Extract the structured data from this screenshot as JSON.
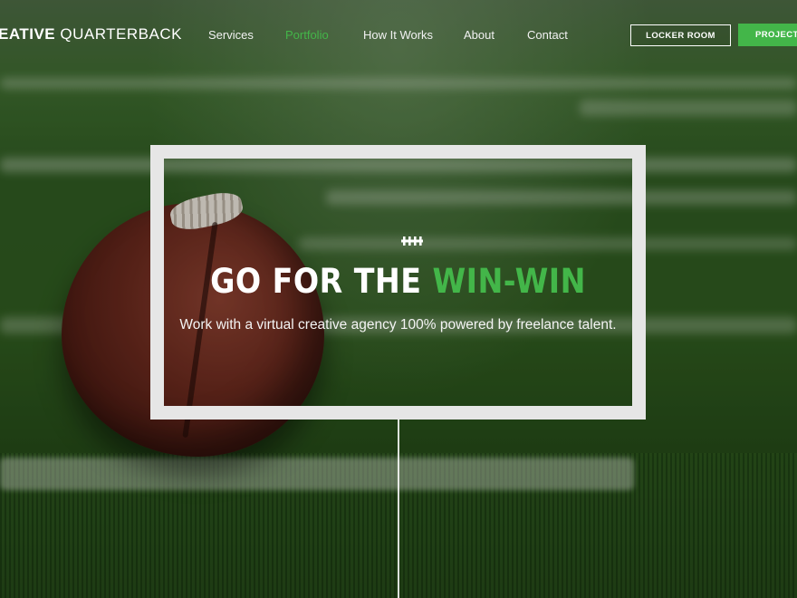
{
  "brand": {
    "logo_bold": "EATIVE",
    "logo_light": " QUARTERBACK"
  },
  "nav": {
    "items": [
      {
        "label": "Services",
        "active": false
      },
      {
        "label": "Portfolio",
        "active": true
      },
      {
        "label": "How It Works",
        "active": false
      },
      {
        "label": "About",
        "active": false
      },
      {
        "label": "Contact",
        "active": false
      }
    ],
    "locker_room": "LOCKER ROOM",
    "project": "PROJECT"
  },
  "hero": {
    "icon": "football-laces-icon",
    "headline_main": "GO FOR THE ",
    "headline_accent": "WIN-WIN",
    "subline": "Work with a virtual creative agency 100% powered by freelance talent."
  },
  "colors": {
    "accent": "#43b649",
    "frame": "#e6e6e6"
  }
}
